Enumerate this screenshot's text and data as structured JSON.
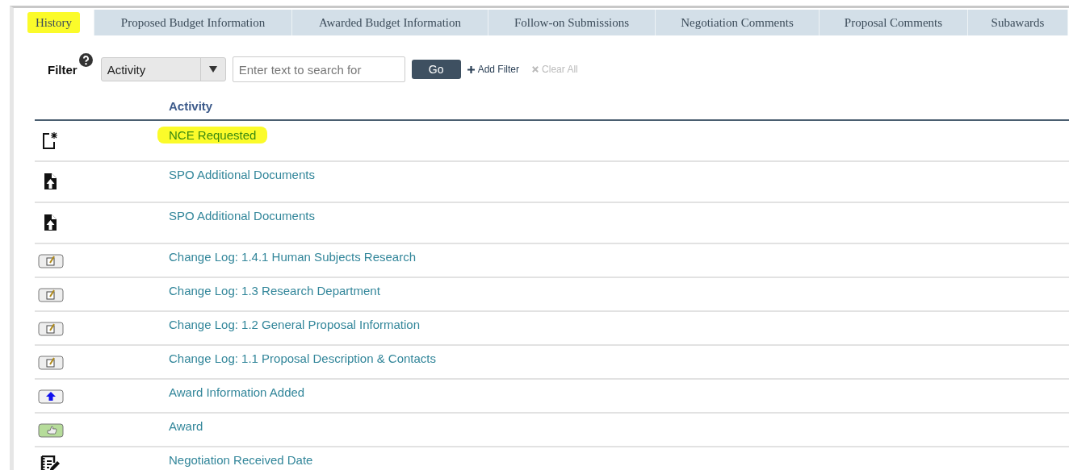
{
  "tabs": [
    {
      "label": "History",
      "selected": true,
      "highlighted": true
    },
    {
      "label": "Proposed Budget Information",
      "selected": false,
      "highlighted": false
    },
    {
      "label": "Awarded Budget Information",
      "selected": false,
      "highlighted": false
    },
    {
      "label": "Follow-on Submissions",
      "selected": false,
      "highlighted": false
    },
    {
      "label": "Negotiation Comments",
      "selected": false,
      "highlighted": false
    },
    {
      "label": "Proposal Comments",
      "selected": false,
      "highlighted": false
    },
    {
      "label": "Subawards",
      "selected": false,
      "highlighted": false
    }
  ],
  "filter": {
    "label": "Filter",
    "field": "Activity",
    "placeholder": "Enter text to search for",
    "go": "Go",
    "add_filter": "Add Filter",
    "clear_all": "Clear All"
  },
  "table": {
    "columns": [
      "Activity"
    ],
    "rows": [
      {
        "kind": "new",
        "activity": "NCE Requested",
        "highlighted": true
      },
      {
        "kind": "upload",
        "activity": "SPO Additional Documents",
        "highlighted": false
      },
      {
        "kind": "upload",
        "activity": "SPO Additional Documents",
        "highlighted": false
      },
      {
        "kind": "changelog",
        "activity": "Change Log: 1.4.1 Human Subjects Research",
        "highlighted": false
      },
      {
        "kind": "changelog",
        "activity": "Change Log: 1.3 Research Department",
        "highlighted": false
      },
      {
        "kind": "changelog",
        "activity": "Change Log: 1.2 General Proposal Information",
        "highlighted": false
      },
      {
        "kind": "changelog",
        "activity": "Change Log: 1.1 Proposal Description & Contacts",
        "highlighted": false
      },
      {
        "kind": "award-info",
        "activity": "Award Information Added",
        "highlighted": false
      },
      {
        "kind": "award",
        "activity": "Award",
        "highlighted": false
      },
      {
        "kind": "negotiation",
        "activity": "Negotiation Received Date",
        "highlighted": false
      }
    ]
  }
}
